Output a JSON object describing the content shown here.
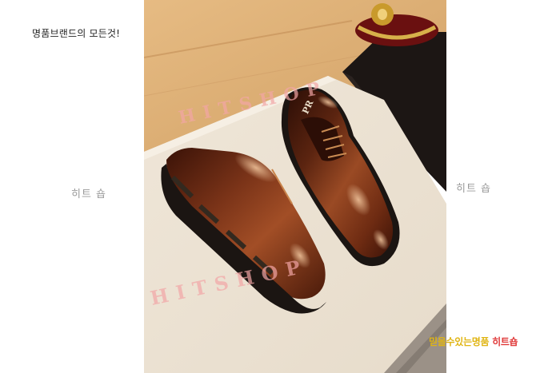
{
  "tagline": "명품브랜드의 모든것!",
  "side_watermarks": {
    "left": "히트 숍",
    "right": "히트 숍"
  },
  "photo_watermark": {
    "top": "HITSHOP",
    "bottom": "HITSHOP"
  },
  "shoe_logo": "PR",
  "promo": {
    "part1": "믿을수있는명품",
    "part2": "히트숍"
  },
  "colors": {
    "wood": "#e2b57d",
    "floor": "#ede3d4",
    "leather": "#6b2a12",
    "sole": "#1b1512",
    "promo_yellow": "#e0b514",
    "promo_red": "#e03a3a"
  }
}
